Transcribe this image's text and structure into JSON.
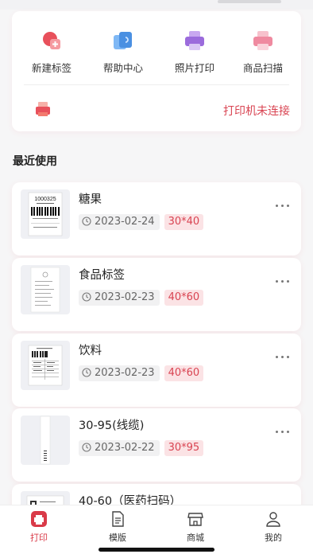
{
  "actions": [
    {
      "label": "新建标签",
      "icon": "new-label-icon",
      "color": "#e8505b"
    },
    {
      "label": "帮助中心",
      "icon": "help-center-icon",
      "color": "#4a90e2"
    },
    {
      "label": "照片打印",
      "icon": "photo-print-icon",
      "color": "#9b6bdc"
    },
    {
      "label": "商品扫描",
      "icon": "product-scan-icon",
      "color": "#ef8aa0"
    }
  ],
  "printer": {
    "status": "打印机未连接",
    "icon": "printer-icon"
  },
  "recent": {
    "title": "最近使用",
    "items": [
      {
        "name": "糖果",
        "date": "2023-02-24",
        "size": "30*40",
        "thumb_text": "1000325"
      },
      {
        "name": "食品标签",
        "date": "2023-02-23",
        "size": "40*60"
      },
      {
        "name": "饮料",
        "date": "2023-02-23",
        "size": "40*60"
      },
      {
        "name": "30-95(线缆)",
        "date": "2023-02-22",
        "size": "30*95"
      },
      {
        "name": "40-60（医药扫码）"
      }
    ]
  },
  "tabs": [
    {
      "label": "打印",
      "icon": "print-tab-icon",
      "active": true
    },
    {
      "label": "模版",
      "icon": "template-tab-icon",
      "active": false
    },
    {
      "label": "商城",
      "icon": "store-tab-icon",
      "active": false
    },
    {
      "label": "我的",
      "icon": "profile-tab-icon",
      "active": false
    }
  ],
  "colors": {
    "accent": "#d94452",
    "tag_bg": "#fbe3e5",
    "date_bg": "#f1f1f2"
  }
}
